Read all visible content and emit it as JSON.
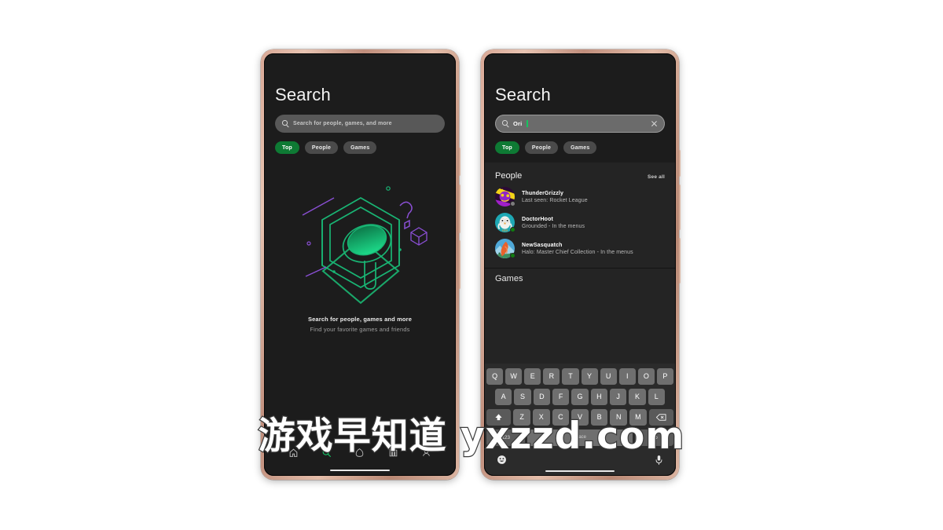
{
  "background_color": "#ffffff",
  "accent_color": "#0e7a34",
  "watermark": {
    "text": "游戏早知道 yxzzd.com"
  },
  "phone_empty": {
    "title": "Search",
    "search": {
      "placeholder": "Search for people, games, and more",
      "value": ""
    },
    "chips": [
      {
        "label": "Top",
        "active": true
      },
      {
        "label": "People",
        "active": false
      },
      {
        "label": "Games",
        "active": false
      }
    ],
    "empty_state": {
      "headline": "Search for people, games and more",
      "subline": "Find your favorite games and friends"
    },
    "nav": [
      {
        "name": "home",
        "active": false
      },
      {
        "name": "search",
        "active": true
      },
      {
        "name": "game-pass",
        "active": false
      },
      {
        "name": "library",
        "active": false
      },
      {
        "name": "profile",
        "active": false
      }
    ]
  },
  "phone_results": {
    "title": "Search",
    "search": {
      "placeholder": "Search for people, games, and more",
      "value": "Ori",
      "clear_label": "Clear"
    },
    "chips": [
      {
        "label": "Top",
        "active": true
      },
      {
        "label": "People",
        "active": false
      },
      {
        "label": "Games",
        "active": false
      }
    ],
    "sections": {
      "people": {
        "title": "People",
        "see_all": "See all",
        "items": [
          {
            "name": "ThunderGrizzly",
            "status": "Last seen: Rocket League",
            "presence": "offline",
            "presence_color": "#7d7d7d"
          },
          {
            "name": "DoctorHoot",
            "status": "Grounded - In the menus",
            "presence": "online",
            "presence_color": "#107c10"
          },
          {
            "name": "NewSasquatch",
            "status": "Halo: Master Chief Collection - In the menus",
            "presence": "online",
            "presence_color": "#107c10"
          }
        ]
      },
      "games": {
        "title": "Games"
      }
    },
    "keyboard": {
      "row1": [
        "Q",
        "W",
        "E",
        "R",
        "T",
        "Y",
        "U",
        "I",
        "O",
        "P"
      ],
      "row2": [
        "A",
        "S",
        "D",
        "F",
        "G",
        "H",
        "J",
        "K",
        "L"
      ],
      "row3": [
        "Z",
        "X",
        "C",
        "V",
        "B",
        "N",
        "M"
      ],
      "shift_key": "shift-icon",
      "backspace_key": "backspace-icon",
      "num_key": "123",
      "space_key": "space",
      "enter_key": "Go",
      "emoji_key": "emoji-icon",
      "mic_key": "microphone-icon"
    }
  }
}
